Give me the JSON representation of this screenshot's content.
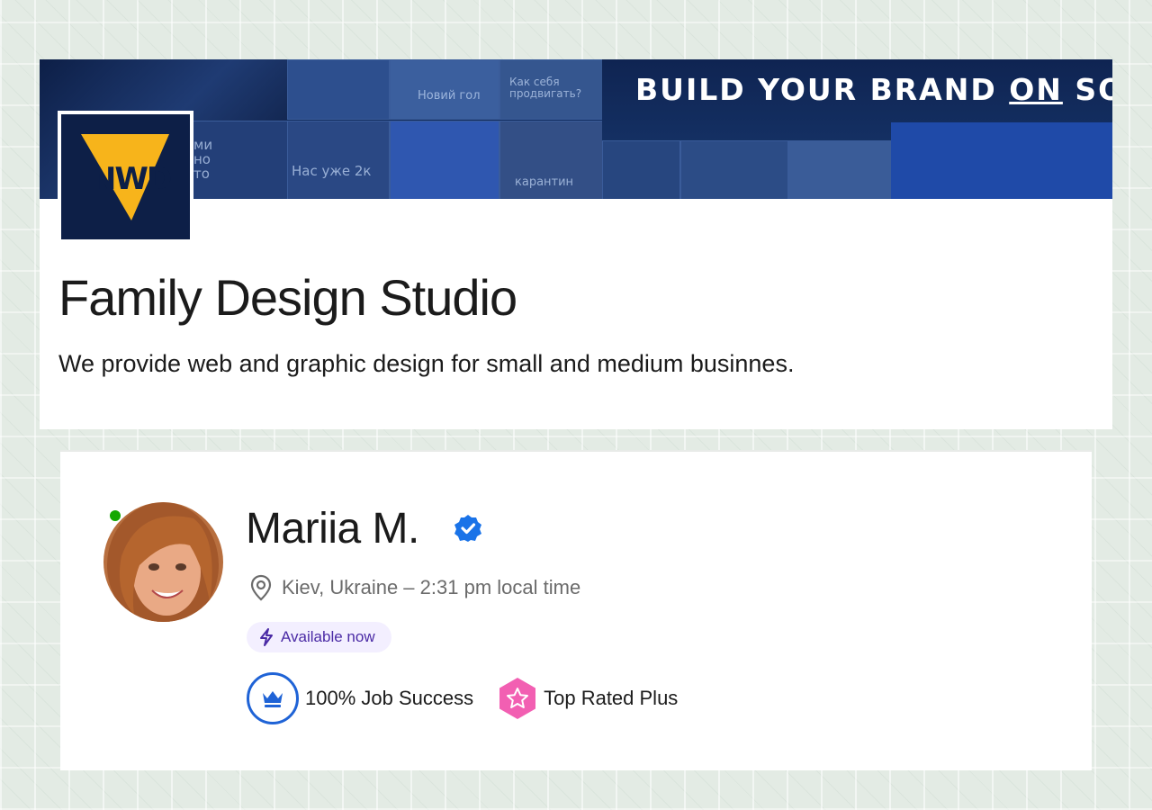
{
  "company": {
    "banner_headline_pre": "BUILD YOUR BRAND ",
    "banner_headline_on": "ON",
    "banner_headline_post": " SO",
    "logo_text": "NWD",
    "tiles": [
      "Новий гол",
      "Как себя продвигать?",
      "ми но то",
      "Нас уже 2к",
      "карантин"
    ],
    "name": "Family Design Studio",
    "description": "We provide web and graphic design for small and medium businnes."
  },
  "profile": {
    "name": "Mariia M.",
    "location": "Kiev, Ukraine – 2:31 pm local time",
    "availability": "Available now",
    "badges": [
      {
        "label": "100% Job Success",
        "icon": "crown-icon"
      },
      {
        "label": "Top Rated Plus",
        "icon": "star-badge-icon"
      }
    ]
  },
  "colors": {
    "banner_navy": "#102a5a",
    "logo_yellow": "#f7b41b",
    "online_green": "#14a800",
    "verified_blue": "#1a73e8",
    "job_success_blue": "#1f63d6",
    "top_rated_pink": "#f25fb2",
    "available_purple": "#4a2aa5"
  }
}
